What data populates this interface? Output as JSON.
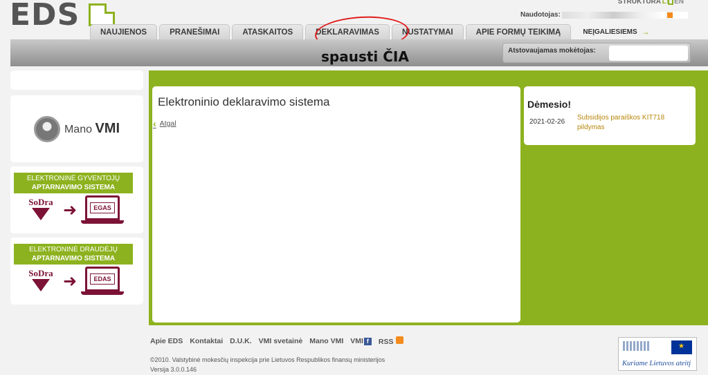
{
  "logo": {
    "text": "EDS"
  },
  "top": {
    "structure": "STRUKTŪRA",
    "lang_lt": "LT",
    "lang_en": "EN",
    "user_label": "Naudotojas:"
  },
  "nav": {
    "tabs": [
      "NAUJIENOS",
      "PRANEŠIMAI",
      "ATASKAITOS",
      "DEKLARAVIMAS",
      "NUSTATYMAI",
      "APIE FORMŲ TEIKIMĄ"
    ],
    "accessibility": "NEĮGALIESIEMS"
  },
  "annotation": {
    "text": "spausti ČIA"
  },
  "representative": {
    "label": "Atstovaujamas mokėtojas:"
  },
  "sidebar": {
    "vmi": {
      "mano": "Mano",
      "vmi": "VMI"
    },
    "egas": {
      "line1": "ELEKTRONINĖ GYVENTOJŲ",
      "line2": "APTARNAVIMO SISTEMA",
      "sodra": "SoDra",
      "screen": "EGAS"
    },
    "edas": {
      "line1": "ELEKTRONINĖ DRAUDĖJŲ",
      "line2": "APTARNAVIMO SISTEMA",
      "sodra": "SoDra",
      "screen": "EDAS"
    }
  },
  "main": {
    "title": "Elektroninio deklaravimo sistema",
    "back": "Atgal"
  },
  "notice": {
    "title": "Dėmesio!",
    "date": "2021-02-26",
    "link": "Subsidijos paraiškos KIT718 pildymas"
  },
  "footer": {
    "links": [
      "Apie EDS",
      "Kontaktai",
      "D.U.K.",
      "VMI svetainė",
      "Mano VMI",
      "VMI",
      "RSS"
    ],
    "copyright": "©2010. Valstybinė mokesčių inspekcija prie Lietuvos Respublikos finansų ministerijos",
    "version": "Versija 3.0.0.146",
    "eu_slogan": "Kuriame Lietuvos ateitį"
  },
  "colors": {
    "accent": "#8db21f",
    "sodra": "#7c1235",
    "circle": "#e21b1b"
  }
}
